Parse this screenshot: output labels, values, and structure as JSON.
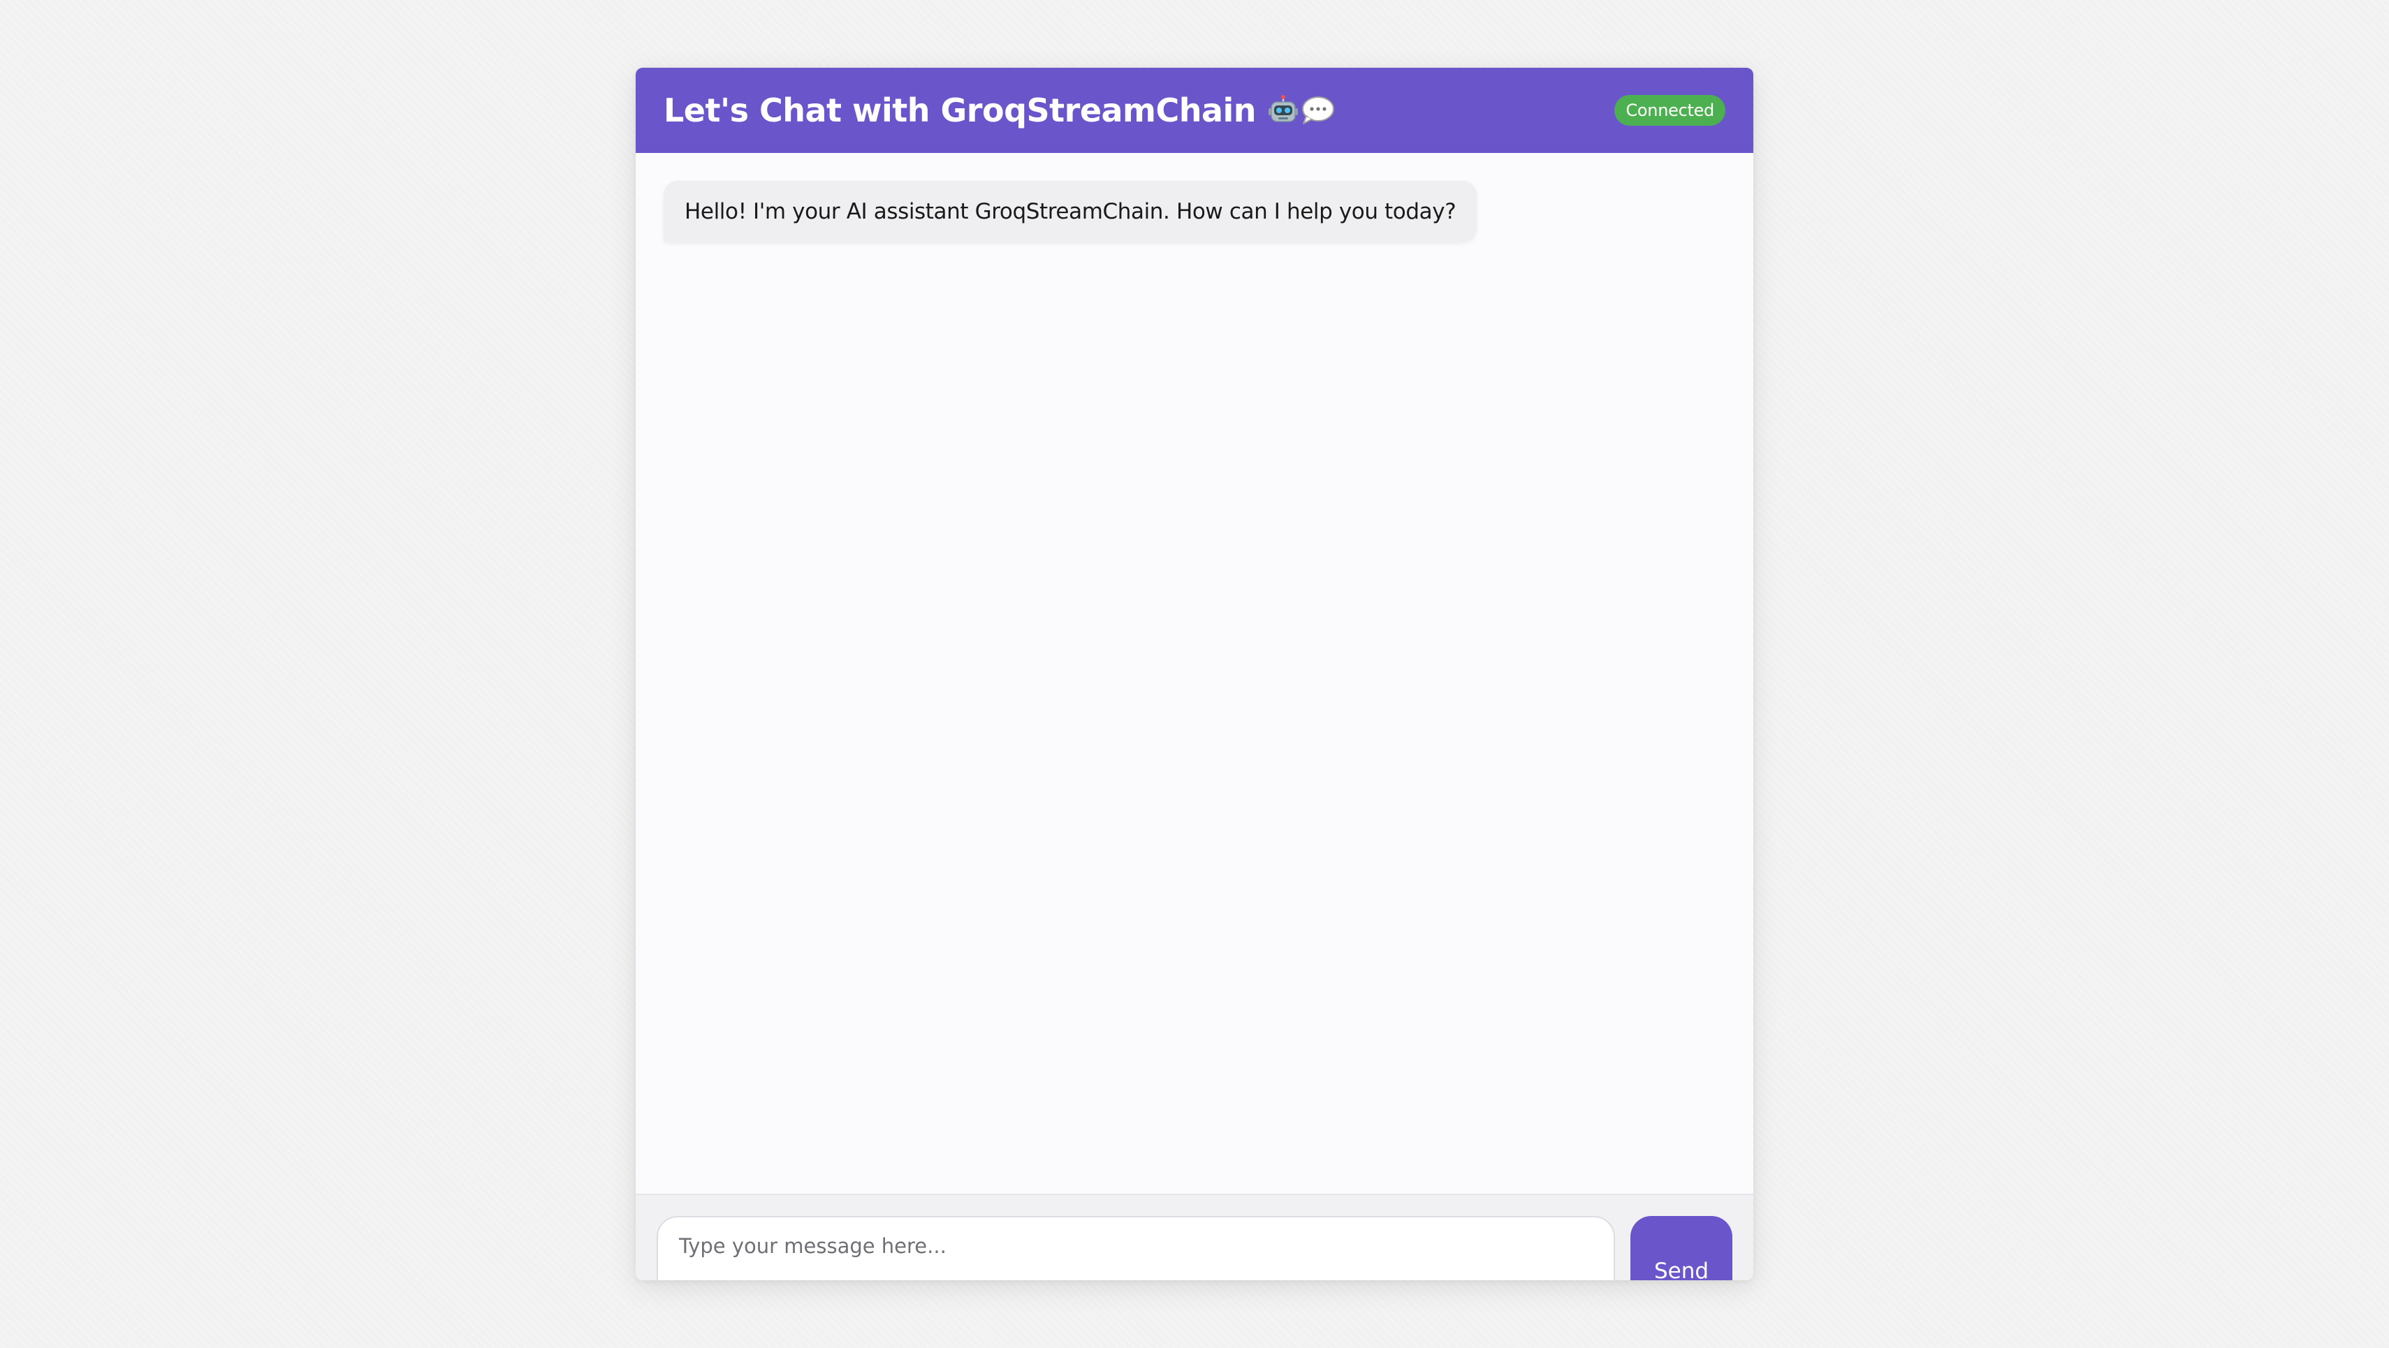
{
  "header": {
    "title": "Let's Chat with GroqStreamChain",
    "icons": [
      "robot-icon",
      "speech-bubble-icon"
    ],
    "status": "Connected"
  },
  "messages": [
    {
      "sender": "bot",
      "text": "Hello! I'm your AI assistant GroqStreamChain. How can I help you today?"
    }
  ],
  "composer": {
    "placeholder": "Type your message here...",
    "value": "",
    "send_label": "Send"
  },
  "colors": {
    "accent": "#6a55ca",
    "status": "#4caf50",
    "page_background": "#f3f3f3",
    "bot_bubble": "#efeff2"
  }
}
